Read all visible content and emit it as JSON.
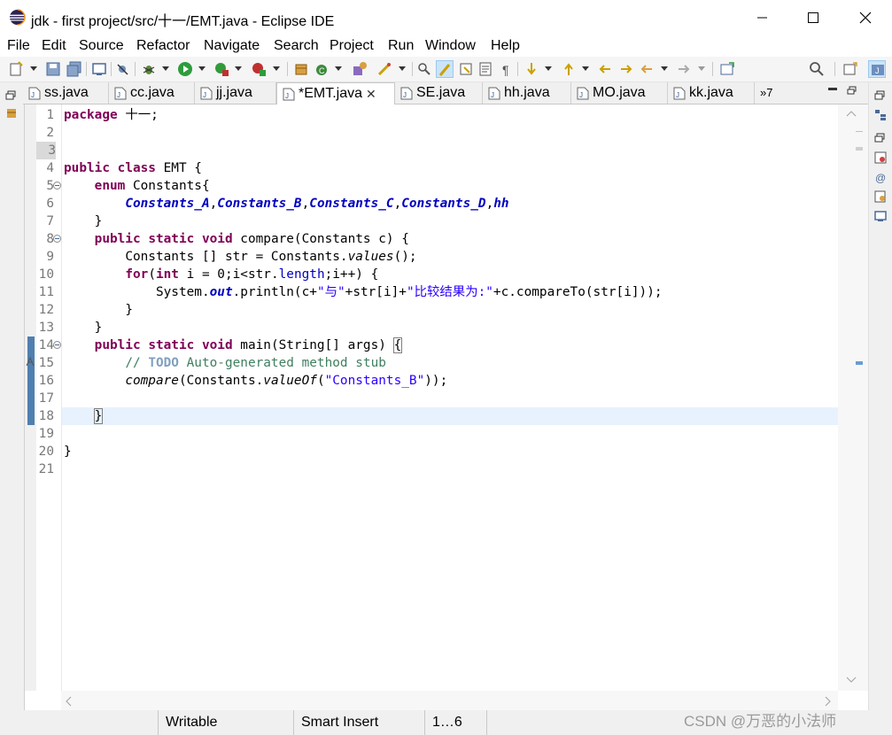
{
  "window": {
    "title": "jdk - first project/src/十一/EMT.java - Eclipse IDE"
  },
  "menu": [
    "File",
    "Edit",
    "Source",
    "Refactor",
    "Navigate",
    "Search",
    "Project",
    "Run",
    "Window",
    "Help"
  ],
  "tabs": [
    {
      "label": "ss.java",
      "icon": "java-file-icon"
    },
    {
      "label": "cc.java",
      "icon": "java-file-icon"
    },
    {
      "label": "jj.java",
      "icon": "java-file-icon"
    },
    {
      "label": "*EMT.java",
      "icon": "java-file-icon",
      "active": true
    },
    {
      "label": "SE.java",
      "icon": "java-file-icon"
    },
    {
      "label": "hh.java",
      "icon": "java-file-icon"
    },
    {
      "label": "MO.java",
      "icon": "java-file-icon"
    },
    {
      "label": "kk.java",
      "icon": "java-file-icon"
    }
  ],
  "tab_overflow": "»7",
  "editor": {
    "line_numbers": [
      "1",
      "2",
      "3",
      "4",
      "5",
      "6",
      "7",
      "8",
      "9",
      "10",
      "11",
      "12",
      "13",
      "14",
      "15",
      "16",
      "17",
      "18",
      "19",
      "20",
      "21"
    ],
    "current_line": 18,
    "code": {
      "l1_kw": "package",
      "l1_rest": " 十一;",
      "l4_kw1": "public",
      "l4_kw2": "class",
      "l4_rest": " EMT {",
      "l5_kw": "enum",
      "l5_rest": " Constants{",
      "l6_a": "Constants_A",
      "l6_b": "Constants_B",
      "l6_c": "Constants_C",
      "l6_d": "Constants_D",
      "l6_e": "hh",
      "comma": ",",
      "l7": "}",
      "l8_kw1": "public",
      "l8_kw2": "static",
      "l8_kw3": "void",
      "l8_rest": " compare(Constants c) {",
      "l9_a": "Constants [] str = Constants.",
      "l9_m": "values",
      "l9_b": "();",
      "l10_kw1": "for",
      "l10_a": "(",
      "l10_kw2": "int",
      "l10_b": " i = 0;i<str.",
      "l10_f": "length",
      "l10_c": ";i++) {",
      "l11_a": "System.",
      "l11_f": "out",
      "l11_b": ".println(c+",
      "l11_s1": "\"与\"",
      "l11_c": "+str[i]+",
      "l11_s2": "\"比较结果为:\"",
      "l11_d": "+c.compareTo(str[i]));",
      "l12": "}",
      "l13": "}",
      "l14_kw1": "public",
      "l14_kw2": "static",
      "l14_kw3": "void",
      "l14_rest": " main(String[] args) ",
      "l14_brace": "{",
      "l15_c1": "// ",
      "l15_todo": "TODO",
      "l15_c2": " Auto-generated method stub",
      "l16_m": "compare",
      "l16_a": "(Constants.",
      "l16_m2": "valueOf",
      "l16_b": "(",
      "l16_s": "\"Constants_B\"",
      "l16_c": "));",
      "l18": "}",
      "l20": "}"
    }
  },
  "status": {
    "writable": "Writable",
    "insert_mode": "Smart Insert",
    "position": "1…6"
  },
  "watermark": "CSDN @万恶的小法师",
  "colors": {
    "keyword": "#7f0055",
    "enum_constant": "#0000c0",
    "string": "#2a00ff",
    "comment": "#3f7f5f",
    "current_line": "#e8f2fe"
  }
}
